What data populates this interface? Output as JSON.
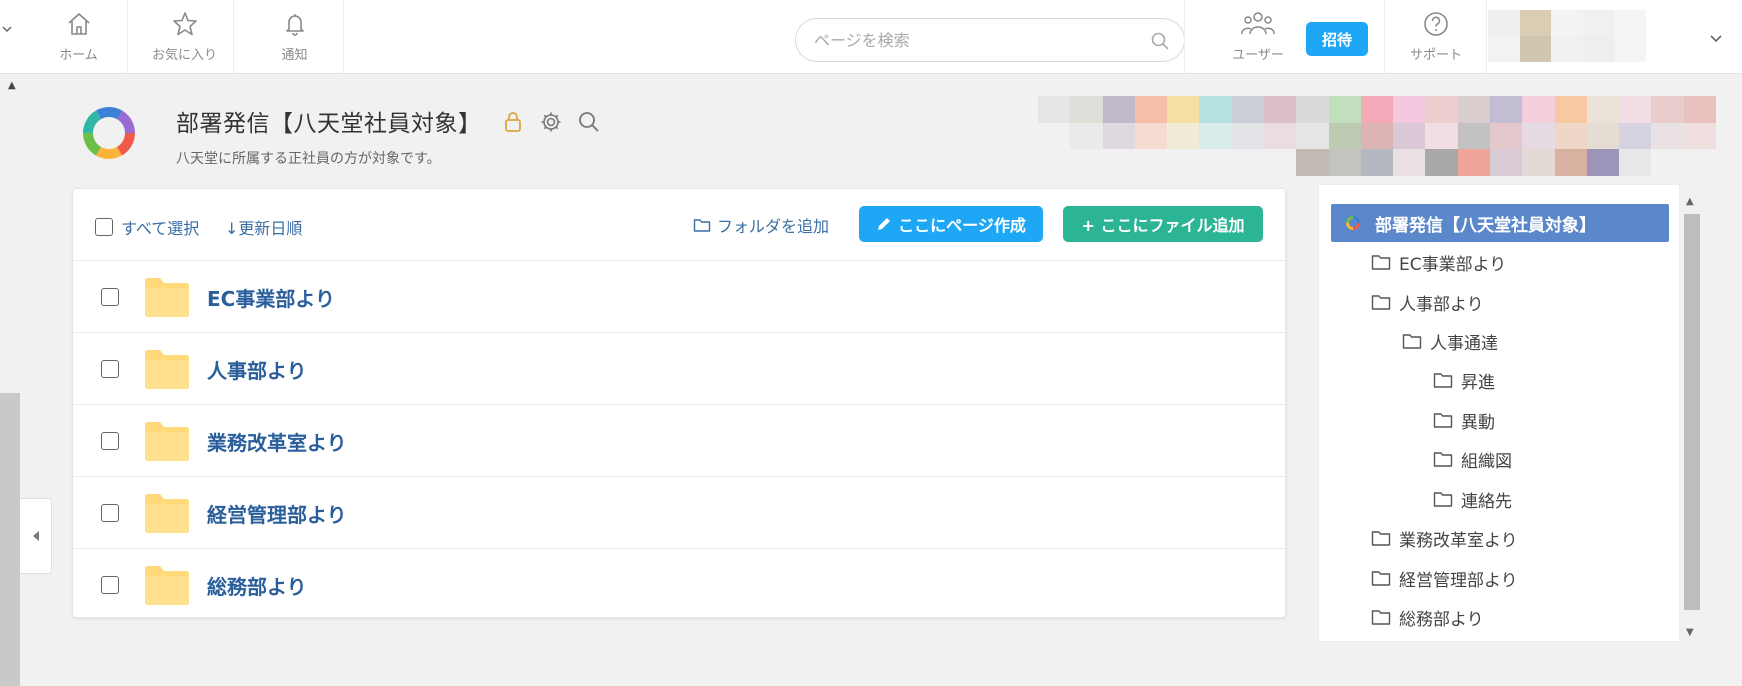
{
  "topbar": {
    "nav": [
      {
        "key": "home",
        "label": "ホーム",
        "icon": "home-icon"
      },
      {
        "key": "favorites",
        "label": "お気に入り",
        "icon": "star-icon"
      },
      {
        "key": "notifications",
        "label": "通知",
        "icon": "bell-icon"
      }
    ],
    "search_placeholder": "ページを検索",
    "users_label": "ユーザー",
    "invite_label": "招待",
    "support_label": "サポート"
  },
  "header": {
    "title": "部署発信【八天堂社員対象】",
    "subtitle": "八天堂に所属する正社員の方が対象です。"
  },
  "toolbar": {
    "select_all": "すべて選択",
    "sort": "↓更新日順",
    "add_folder": "フォルダを追加",
    "create_page": "ここにページ作成",
    "add_file": "+ ここにファイル追加"
  },
  "folders": [
    {
      "name": "EC事業部より"
    },
    {
      "name": "人事部より"
    },
    {
      "name": "業務改革室より"
    },
    {
      "name": "経営管理部より"
    },
    {
      "name": "総務部より"
    }
  ],
  "tree": {
    "root": "部署発信【八天堂社員対象】",
    "items": [
      {
        "label": "EC事業部より",
        "level": 1
      },
      {
        "label": "人事部より",
        "level": 1
      },
      {
        "label": "人事通達",
        "level": 2
      },
      {
        "label": "昇進",
        "level": 3
      },
      {
        "label": "異動",
        "level": 3
      },
      {
        "label": "組織図",
        "level": 3
      },
      {
        "label": "連絡先",
        "level": 3
      },
      {
        "label": "業務改革室より",
        "level": 1
      },
      {
        "label": "経営管理部より",
        "level": 1
      },
      {
        "label": "総務部より",
        "level": 1
      }
    ]
  },
  "colors": {
    "primary_blue": "#1ea7f4",
    "green": "#2bb594",
    "tree_selected": "#5b88cb",
    "folder_yellow": "#ffd97a",
    "link_blue": "#3a6ea5"
  }
}
